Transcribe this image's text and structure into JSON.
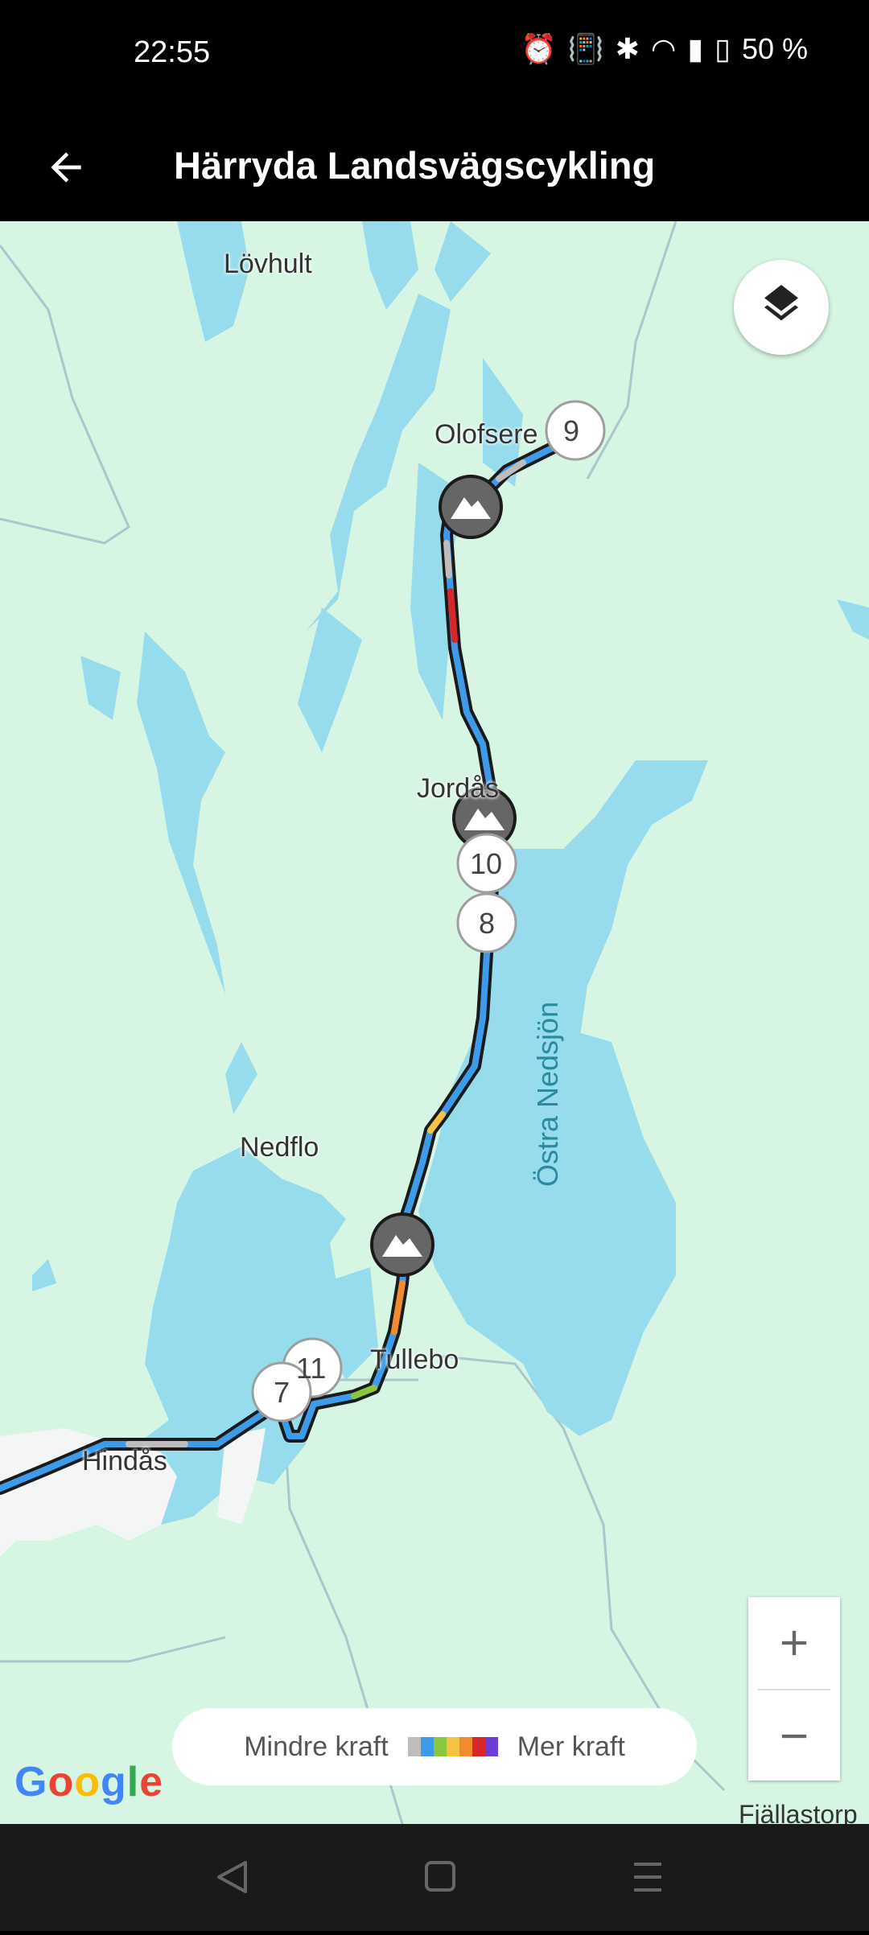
{
  "status_bar": {
    "time": "22:55",
    "battery": "50 %"
  },
  "app_bar": {
    "title": "Härryda Landsvägscykling"
  },
  "map": {
    "places": {
      "lovhult": "Lövhult",
      "olofsered": "Olofsere",
      "jordas": "Jordås",
      "nedflo": "Nedflo",
      "tullebo": "Tullebo",
      "hindas": "Hindås",
      "fjallastorp": "Fjällastorp"
    },
    "lake_label": "Östra Nedsjön",
    "markers": {
      "m9": "9",
      "m10": "10",
      "m8": "8",
      "m11": "11",
      "m7": "7"
    },
    "colors": {
      "land": "#d6f5e3",
      "water": "#96dcec",
      "route_outline": "#1a1a1a",
      "marker_dark": "#666666"
    }
  },
  "legend": {
    "less_label": "Mindre kraft",
    "more_label": "Mer kraft",
    "scale_colors": [
      "#bdbdbd",
      "#3d9be9",
      "#8bc63f",
      "#f5c342",
      "#f28b30",
      "#d9262a",
      "#6b3fd6"
    ]
  },
  "google": {
    "logo": "Google"
  }
}
